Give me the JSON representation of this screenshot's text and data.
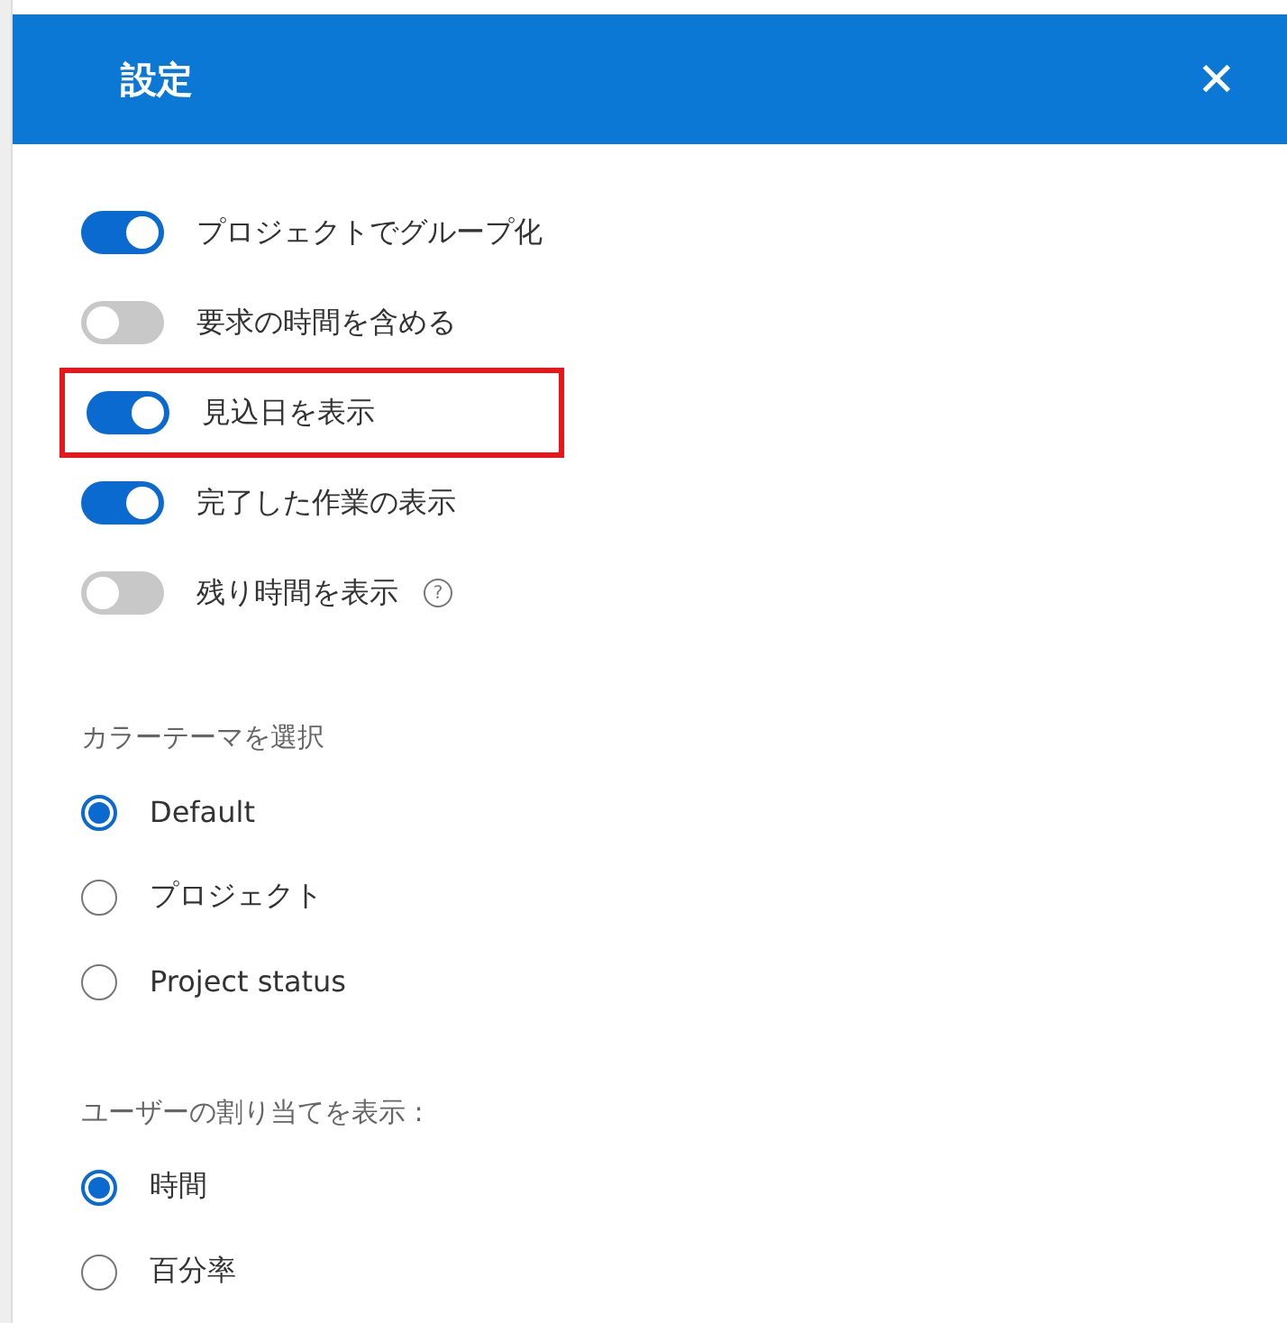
{
  "panel": {
    "title": "設定",
    "close": "✕"
  },
  "toggles": [
    {
      "label": "プロジェクトでグループ化",
      "on": true,
      "highlighted": false
    },
    {
      "label": "要求の時間を含める",
      "on": false,
      "highlighted": false
    },
    {
      "label": "見込日を表示",
      "on": true,
      "highlighted": true
    },
    {
      "label": "完了した作業の表示",
      "on": true,
      "highlighted": false
    },
    {
      "label": "残り時間を表示",
      "on": false,
      "highlighted": false,
      "help": "?"
    }
  ],
  "groups": [
    {
      "label": "カラーテーマを選択",
      "options": [
        {
          "label": "Default",
          "selected": true
        },
        {
          "label": "プロジェクト",
          "selected": false
        },
        {
          "label": "Project status",
          "selected": false
        }
      ]
    },
    {
      "label": "ユーザーの割り当てを表示 :",
      "options": [
        {
          "label": "時間",
          "selected": true
        },
        {
          "label": "百分率",
          "selected": false
        }
      ]
    }
  ]
}
